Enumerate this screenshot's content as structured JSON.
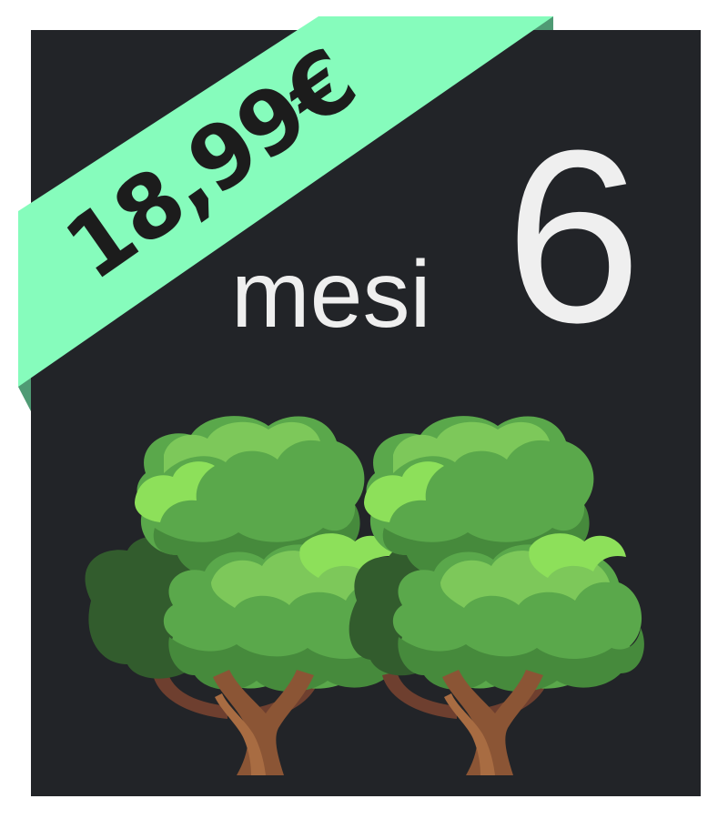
{
  "offer": {
    "price": "18,99€",
    "duration_unit": "mesi",
    "duration_value": "6"
  },
  "illustration": {
    "icon": "trees-icon",
    "tree_count": 2
  },
  "colors": {
    "card_background": "#222428",
    "ribbon": "#86fcbc",
    "ribbon_fold": "#4f9a74",
    "price_text": "#1c1c1c",
    "duration_text": "#efefef",
    "foliage_dark": "#325c2d",
    "foliage_mid": "#468a3c",
    "foliage_main": "#5aa84b",
    "foliage_light": "#7dc85a",
    "foliage_highlight": "#8de05a",
    "trunk": "#8b5535",
    "trunk_light": "#a86c42",
    "branch_back": "#6e3f2f"
  }
}
